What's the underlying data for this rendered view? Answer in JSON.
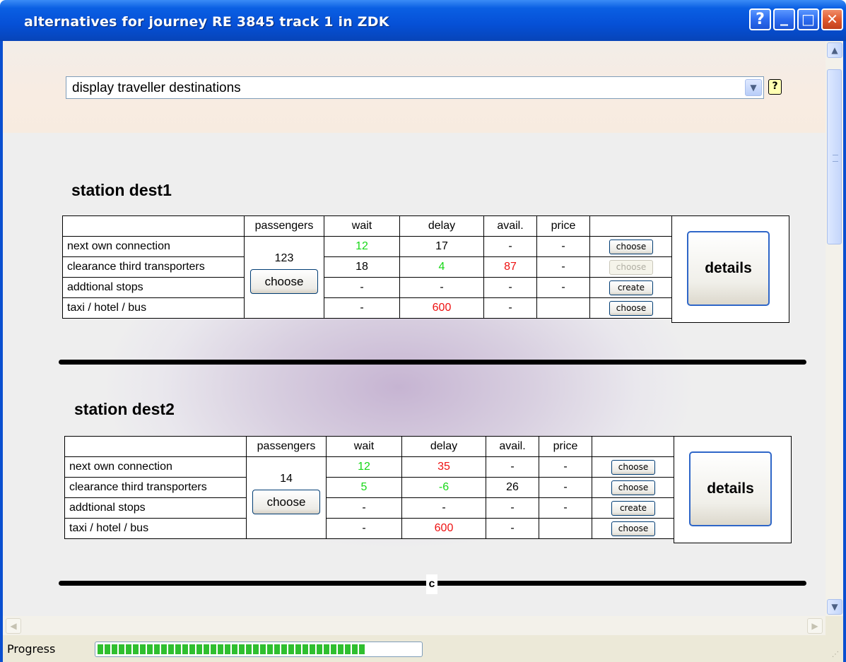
{
  "window": {
    "title": "alternatives for journey RE 3845 track 1 in ZDK",
    "help_glyph": "?",
    "minimize_glyph": "_",
    "maximize_glyph": "□",
    "close_glyph": "✕"
  },
  "view_select": {
    "value": "display traveller destinations",
    "help_glyph": "?"
  },
  "table_headers": {
    "passengers": "passengers",
    "wait": "wait",
    "delay": "delay",
    "avail": "avail.",
    "price": "price"
  },
  "stations": [
    {
      "title": "station dest1",
      "passengers": "123",
      "passengers_button": "choose",
      "details_label": "details",
      "rows": [
        {
          "label": "next own connection",
          "wait": "12",
          "delay": "17",
          "avail": "-",
          "price": "-",
          "action": "choose",
          "action_disabled": false
        },
        {
          "label": "clearance third transporters",
          "wait": "18",
          "delay": "4",
          "avail": "87",
          "price": "-",
          "action": "choose",
          "action_disabled": true
        },
        {
          "label": "addtional stops",
          "wait": "-",
          "delay": "-",
          "avail": "-",
          "price": "-",
          "action": "create",
          "action_disabled": false
        },
        {
          "label": "taxi / hotel / bus",
          "wait": "-",
          "delay": "600",
          "avail": "-",
          "price": "",
          "action": "choose",
          "action_disabled": false
        }
      ]
    },
    {
      "title": "station dest2",
      "passengers": "14",
      "passengers_button": "choose",
      "details_label": "details",
      "rows": [
        {
          "label": "next own connection",
          "wait": "12",
          "delay": "35",
          "avail": "-",
          "price": "-",
          "action": "choose",
          "action_disabled": false
        },
        {
          "label": "clearance third transporters",
          "wait": "5",
          "delay": "-6",
          "avail": "26",
          "price": "-",
          "action": "choose",
          "action_disabled": false
        },
        {
          "label": "addtional stops",
          "wait": "-",
          "delay": "-",
          "avail": "-",
          "price": "-",
          "action": "create",
          "action_disabled": false
        },
        {
          "label": "taxi / hotel / bus",
          "wait": "-",
          "delay": "600",
          "avail": "-",
          "price": "",
          "action": "choose",
          "action_disabled": false
        }
      ]
    }
  ],
  "separator_marker": "c",
  "status": {
    "label": "Progress",
    "progress_fraction": 0.83
  },
  "colors": {
    "good": "#16d716",
    "bad": "#ee1111",
    "titlebar": "#0650d6"
  }
}
